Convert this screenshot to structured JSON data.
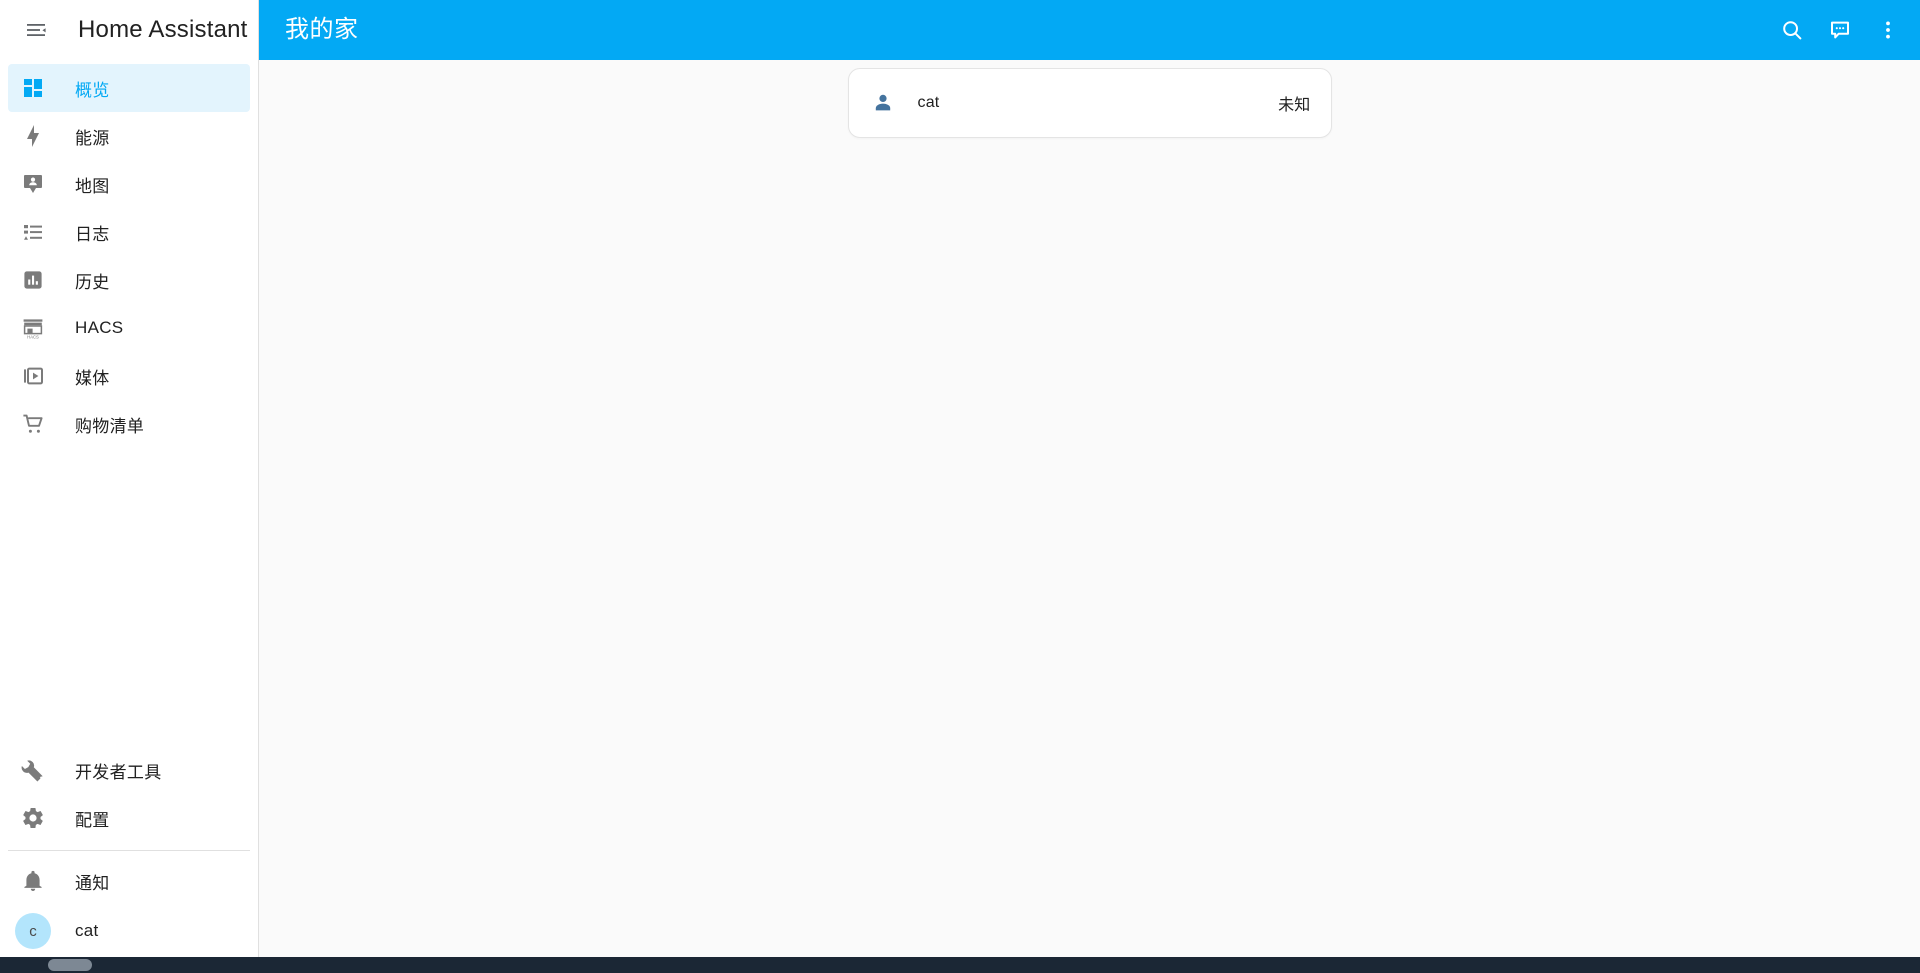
{
  "sidebar": {
    "menu_icon": "menu-collapse-icon",
    "title": "Home Assistant",
    "items": [
      {
        "label": "概览",
        "icon": "view-dashboard-icon",
        "active": true
      },
      {
        "label": "能源",
        "icon": "lightning-bolt-icon",
        "active": false
      },
      {
        "label": "地图",
        "icon": "map-marker-account-icon",
        "active": false
      },
      {
        "label": "日志",
        "icon": "format-list-bulleted-icon",
        "active": false
      },
      {
        "label": "历史",
        "icon": "chart-box-icon",
        "active": false
      },
      {
        "label": "HACS",
        "icon": "hacs-storefront-icon",
        "active": false
      },
      {
        "label": "媒体",
        "icon": "play-box-multiple-icon",
        "active": false
      },
      {
        "label": "购物清单",
        "icon": "cart-icon",
        "active": false
      }
    ],
    "tools": [
      {
        "label": "开发者工具",
        "icon": "wrench-icon"
      },
      {
        "label": "配置",
        "icon": "cog-icon"
      }
    ],
    "notifications": {
      "label": "通知",
      "icon": "bell-icon"
    },
    "user": {
      "name": "cat",
      "initial": "c",
      "avatar_color": "#b3e5fc"
    }
  },
  "appbar": {
    "title": "我的家",
    "accent_color": "#03a9f4",
    "actions": [
      {
        "name": "search-icon",
        "label": "搜索"
      },
      {
        "name": "assist-icon",
        "label": "Assist"
      },
      {
        "name": "overflow-menu-icon",
        "label": "更多"
      }
    ]
  },
  "content": {
    "cards": [
      {
        "rows": [
          {
            "icon": "account-icon",
            "name": "cat",
            "state": "未知"
          }
        ]
      }
    ]
  },
  "colors": {
    "accent": "#03a9f4",
    "active_bg": "#e3f4fd",
    "text_primary": "#212121",
    "icon_gray": "#7b7b7b",
    "entity_icon": "#44739e",
    "page_bg": "#fafafa",
    "card_bg": "#ffffff"
  }
}
